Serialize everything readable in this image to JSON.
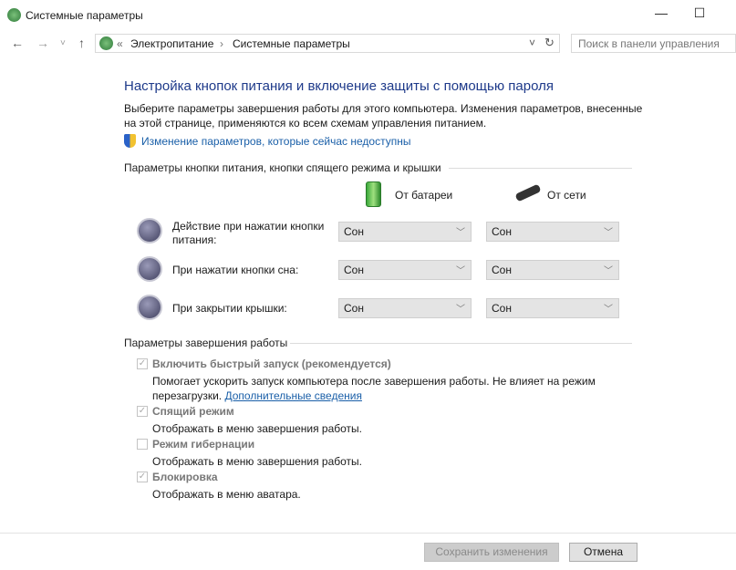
{
  "window": {
    "title": "Системные параметры",
    "minimize": "—",
    "maximize": "☐"
  },
  "nav": {
    "back": "←",
    "forward": "→",
    "recent": "˅",
    "up": "↑",
    "refresh": "↻",
    "dropdown": "˅",
    "breadcrumb": [
      "«",
      "Электропитание",
      "›",
      "Системные параметры"
    ],
    "search_placeholder": "Поиск в панели управления"
  },
  "main": {
    "heading": "Настройка кнопок питания и включение защиты с помощью пароля",
    "description": "Выберите параметры завершения работы для этого компьютера. Изменения параметров, внесенные на этой странице, применяются ко всем схемам управления питанием.",
    "unavailable_link": "Изменение параметров, которые сейчас недоступны",
    "section1": "Параметры кнопки питания, кнопки спящего режима и крышки",
    "col_battery": "От батареи",
    "col_ac": "От сети",
    "rows": [
      {
        "label": "Действие при нажатии кнопки питания:",
        "battery": "Сон",
        "ac": "Сон",
        "icon": "power-button-icon"
      },
      {
        "label": "При нажатии кнопки сна:",
        "battery": "Сон",
        "ac": "Сон",
        "icon": "sleep-button-icon"
      },
      {
        "label": "При закрытии крышки:",
        "battery": "Сон",
        "ac": "Сон",
        "icon": "laptop-lid-icon"
      }
    ],
    "section2": "Параметры завершения работы",
    "options": [
      {
        "label": "Включить быстрый запуск (рекомендуется)",
        "checked": true,
        "desc": "Помогает ускорить запуск компьютера после завершения работы. Не влияет на режим перезагрузки.",
        "link": "Дополнительные сведения"
      },
      {
        "label": "Спящий режим",
        "checked": true,
        "desc": "Отображать в меню завершения работы."
      },
      {
        "label": "Режим гибернации",
        "checked": false,
        "desc": "Отображать в меню завершения работы."
      },
      {
        "label": "Блокировка",
        "checked": true,
        "desc": "Отображать в меню аватара."
      }
    ]
  },
  "footer": {
    "save": "Сохранить изменения",
    "cancel": "Отмена"
  },
  "check_glyph": "✓",
  "chev": "﹀"
}
